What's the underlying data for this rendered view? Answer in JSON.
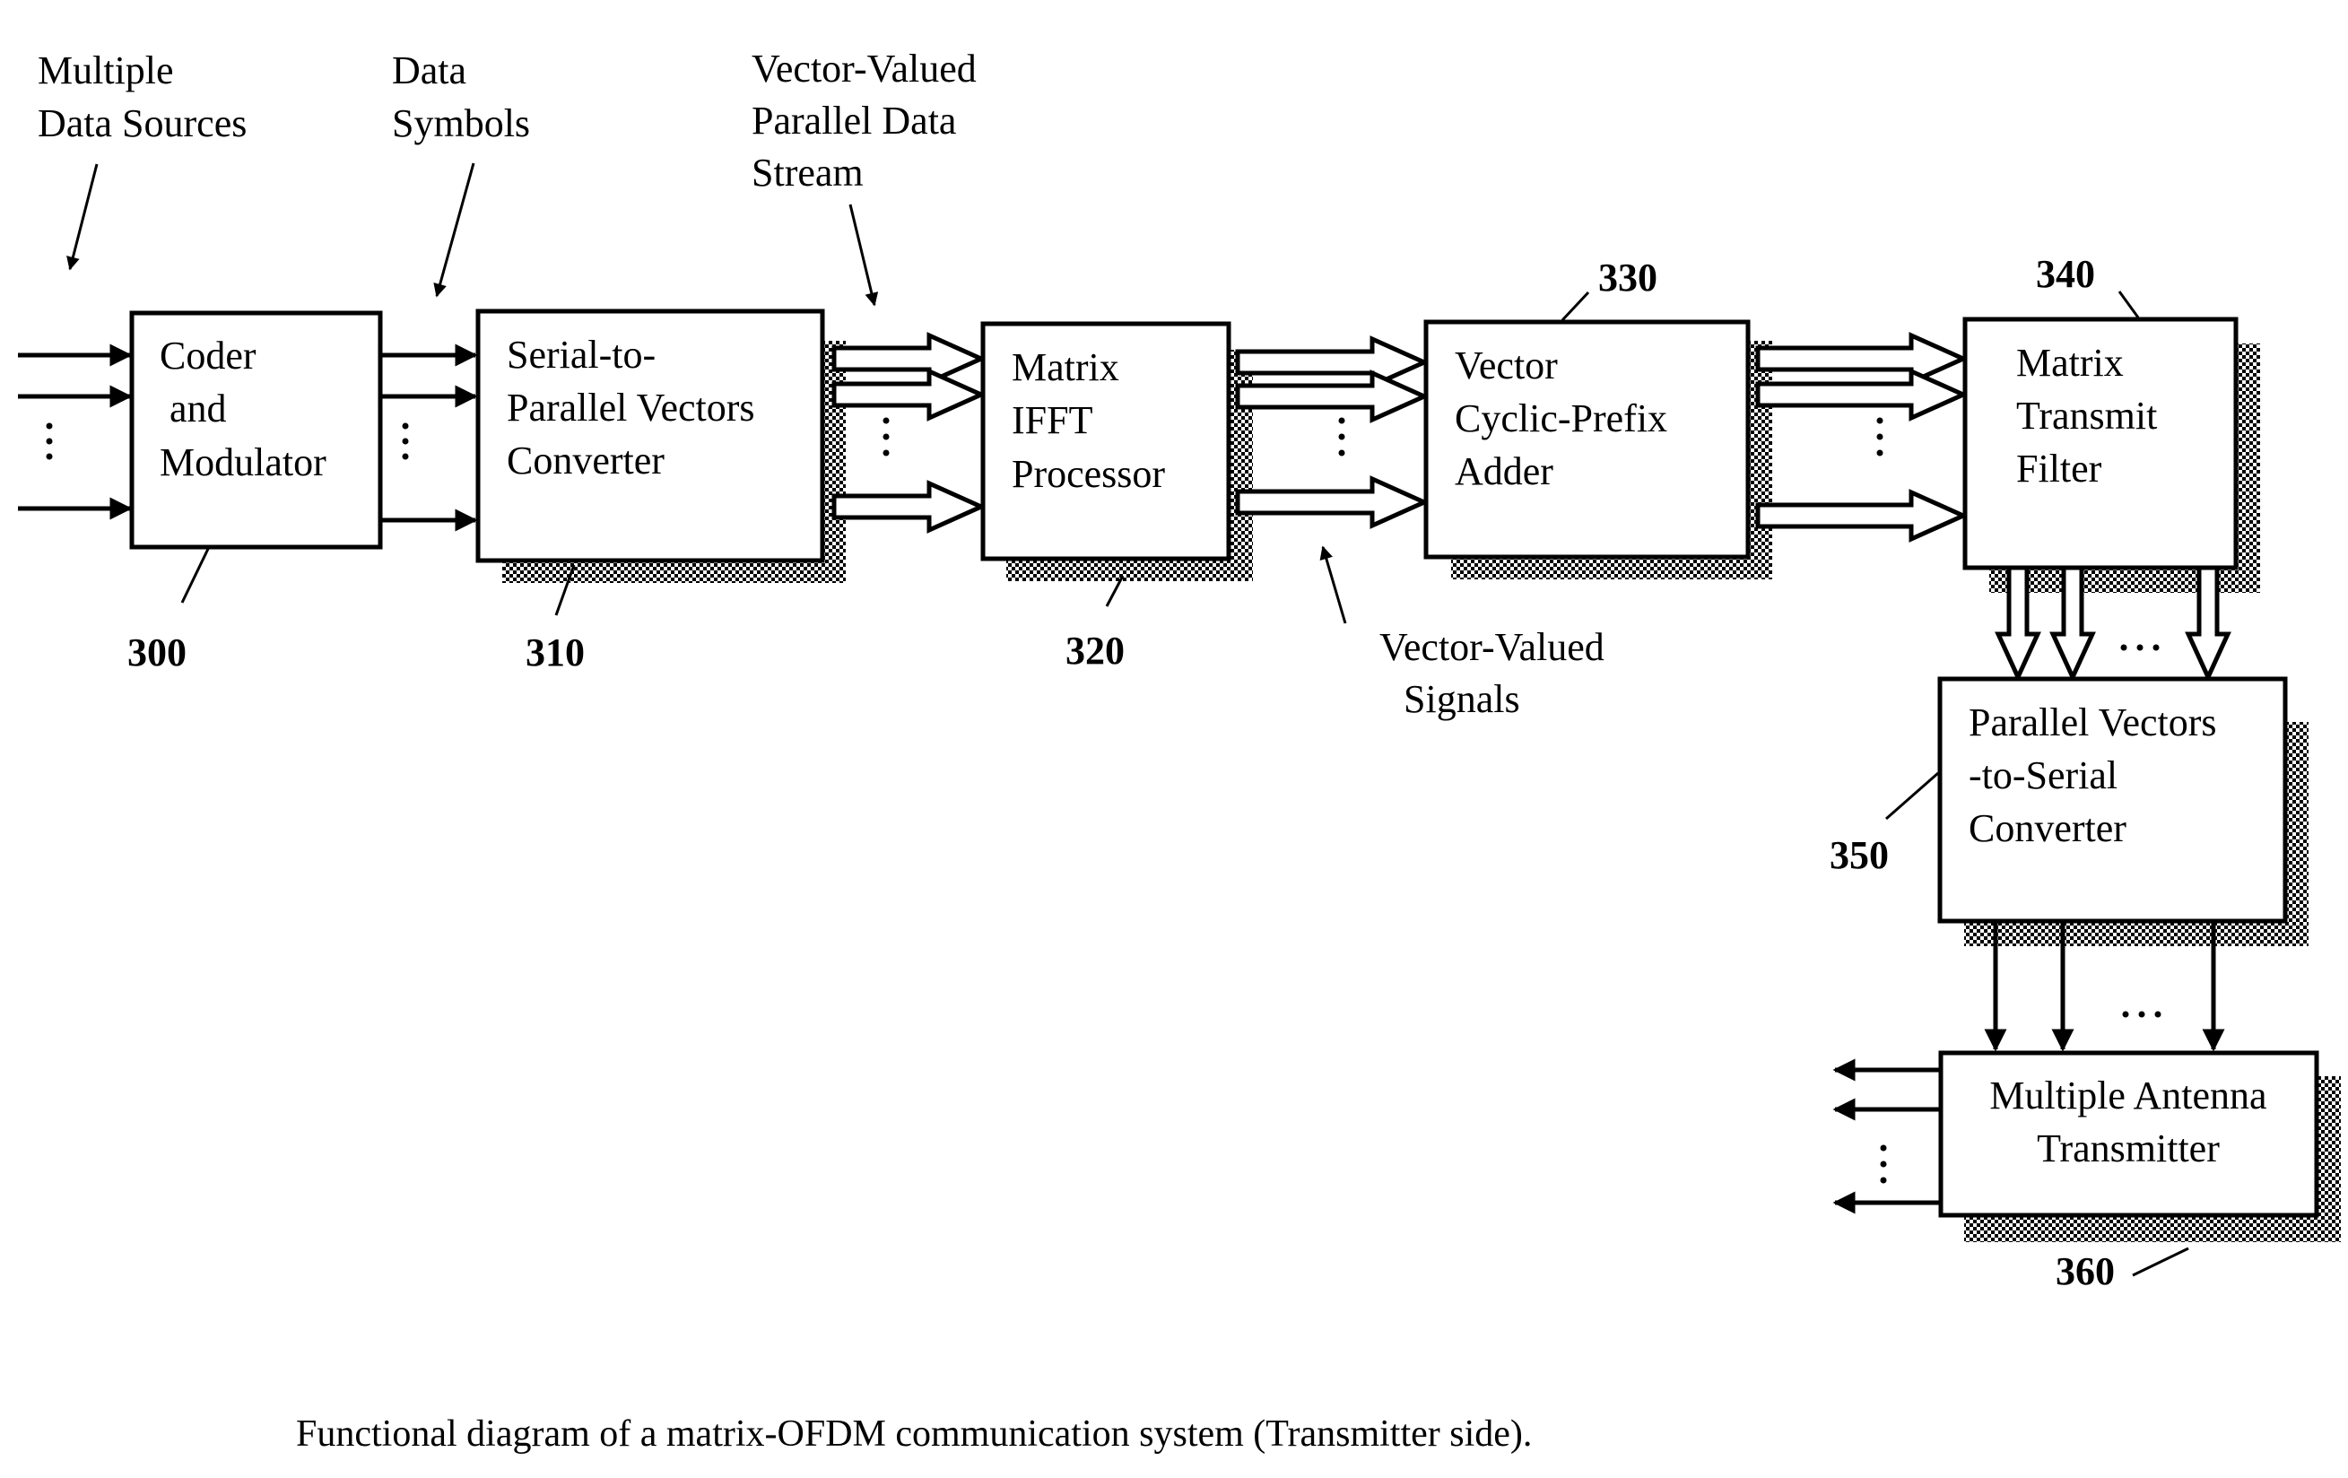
{
  "diagram": {
    "title": "Functional diagram of a matrix-OFDM communication system (Transmitter side).",
    "annotations": {
      "multiple_data_sources": [
        "Multiple",
        "Data Sources"
      ],
      "data_symbols": [
        "Data",
        "Symbols"
      ],
      "vector_valued_stream": [
        "Vector-Valued",
        "Parallel Data",
        "Stream"
      ],
      "vector_valued_signals": [
        "Vector-Valued",
        "Signals"
      ]
    },
    "blocks": [
      {
        "id": "300",
        "ref": "300",
        "lines": [
          "Coder",
          " and",
          "Modulator"
        ]
      },
      {
        "id": "310",
        "ref": "310",
        "lines": [
          "Serial-to-",
          "Parallel Vectors",
          "Converter"
        ]
      },
      {
        "id": "320",
        "ref": "320",
        "lines": [
          "Matrix",
          "IFFT",
          "Processor"
        ]
      },
      {
        "id": "330",
        "ref": "330",
        "lines": [
          "Vector",
          "Cyclic-Prefix",
          "Adder"
        ]
      },
      {
        "id": "340",
        "ref": "340",
        "lines": [
          "Matrix",
          "Transmit",
          "Filter"
        ]
      },
      {
        "id": "350",
        "ref": "350",
        "lines": [
          "Parallel Vectors",
          "-to-Serial",
          "Converter"
        ]
      },
      {
        "id": "360",
        "ref": "360",
        "lines": [
          "Multiple Antenna",
          "Transmitter"
        ]
      }
    ],
    "connections": [
      {
        "from": "inputs",
        "to": "300",
        "kind": "scalar",
        "count_shown": 3,
        "ellipsis": true
      },
      {
        "from": "300",
        "to": "310",
        "kind": "scalar",
        "count_shown": 3,
        "ellipsis": true
      },
      {
        "from": "310",
        "to": "320",
        "kind": "vector",
        "count_shown": 3,
        "ellipsis": true
      },
      {
        "from": "320",
        "to": "330",
        "kind": "vector",
        "count_shown": 3,
        "ellipsis": true
      },
      {
        "from": "330",
        "to": "340",
        "kind": "vector",
        "count_shown": 3,
        "ellipsis": true
      },
      {
        "from": "340",
        "to": "350",
        "kind": "vector",
        "count_shown": 3,
        "ellipsis": true
      },
      {
        "from": "350",
        "to": "360",
        "kind": "scalar",
        "count_shown": 3,
        "ellipsis": true
      },
      {
        "from": "360",
        "to": "outputs",
        "kind": "scalar",
        "count_shown": 3,
        "ellipsis": true
      }
    ],
    "ellipsis_vertical": "⋮",
    "ellipsis_horizontal": "…"
  }
}
